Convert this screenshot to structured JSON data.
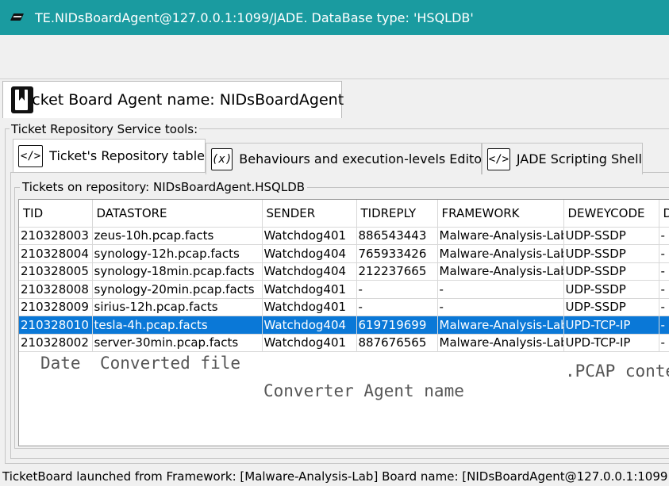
{
  "window": {
    "title": "TE.NIDsBoardAgent@127.0.0.1:1099/JADE. DataBase type: 'HSQLDB'"
  },
  "agent_tab": {
    "label": "Ticket Board Agent name: NIDsBoardAgent",
    "icon": "book-icon"
  },
  "tools": {
    "legend": "Ticket Repository Service tools:",
    "tabs": [
      {
        "label": "Ticket's Repository table",
        "icon_glyph": "</>",
        "active": true
      },
      {
        "label": "Behaviours and execution-levels Editor",
        "icon_glyph": "(x)",
        "active": false
      },
      {
        "label": "JADE Scripting Shell",
        "icon_glyph": "</>",
        "active": false
      }
    ]
  },
  "repository": {
    "legend": "Tickets on repository: NIDsBoardAgent.HSQLDB",
    "columns": [
      "TID",
      "DATASTORE",
      "SENDER",
      "TIDREPLY",
      "FRAMEWORK",
      "DEWEYCODE",
      "D"
    ],
    "rows": [
      [
        "210328003",
        "zeus-10h.pcap.facts",
        "Watchdog401",
        "886543443",
        "Malware-Analysis-Lab",
        "UDP-SSDP",
        "-"
      ],
      [
        "210328004",
        "synology-12h.pcap.facts",
        "Watchdog404",
        "765933426",
        "Malware-Analysis-Lab",
        "UDP-SSDP",
        "-"
      ],
      [
        "210328005",
        "synology-18min.pcap.facts",
        "Watchdog404",
        "212237665",
        "Malware-Analysis-Lab",
        "UDP-SSDP",
        "-"
      ],
      [
        "210328008",
        "synology-20min.pcap.facts",
        "Watchdog401",
        "-",
        "-",
        "UDP-SSDP",
        "-"
      ],
      [
        "210328009",
        "sirius-12h.pcap.facts",
        "Watchdog401",
        "-",
        "-",
        "UDP-SSDP",
        "-"
      ],
      [
        "210328010",
        "tesla-4h.pcap.facts",
        "Watchdog404",
        "619719699",
        "Malware-Analysis-Lab",
        "UPD-TCP-IP",
        "-"
      ],
      [
        "210328002",
        "server-30min.pcap.facts",
        "Watchdog401",
        "887676565",
        "Malware-Analysis-Lab",
        "UPD-TCP-IP",
        "-"
      ]
    ],
    "selected_row_index": 5,
    "selection_color": "#0a78d7"
  },
  "hints": {
    "date": "Date",
    "converted_file": "Converted file",
    "agent_name": "Converter Agent name",
    "pcap": ".PCAP conte"
  },
  "status": {
    "text": "TicketBoard launched from Framework: [Malware-Analysis-Lab] Board name: [NIDsBoardAgent@127.0.0.1:1099"
  },
  "colors": {
    "titlebar": "#1a9ba0"
  }
}
